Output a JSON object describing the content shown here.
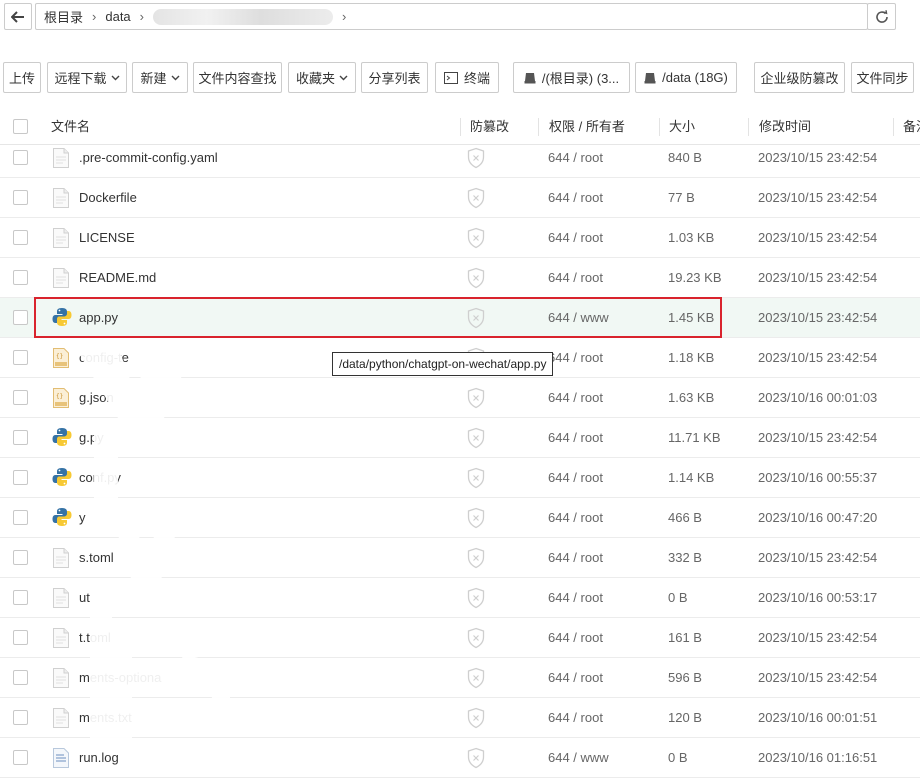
{
  "breadcrumb": {
    "root": "根目录",
    "seg1": "data"
  },
  "toolbar": {
    "upload": "上传",
    "remote_download": "远程下载",
    "new": "新建",
    "content_search": "文件内容查找",
    "favorites": "收藏夹",
    "share_list": "分享列表",
    "terminal": "终端",
    "disk_root": "/(根目录) (3...",
    "disk_data": "/data (18G)",
    "tamper_protect": "企业级防篡改",
    "file_sync": "文件同步"
  },
  "table": {
    "headers": {
      "name": "文件名",
      "tamper": "防篡改",
      "perm": "权限 / 所有者",
      "size": "大小",
      "mtime": "修改时间",
      "note": "备注"
    },
    "rows": [
      {
        "name": ".pre-commit-config.yaml",
        "perm": "644 / root",
        "size": "840 B",
        "mtime": "2023/10/15 23:42:54",
        "icon": "file-icon"
      },
      {
        "name": "Dockerfile",
        "perm": "644 / root",
        "size": "77 B",
        "mtime": "2023/10/15 23:42:54",
        "icon": "file-icon"
      },
      {
        "name": "LICENSE",
        "perm": "644 / root",
        "size": "1.03 KB",
        "mtime": "2023/10/15 23:42:54",
        "icon": "file-icon"
      },
      {
        "name": "README.md",
        "perm": "644 / root",
        "size": "19.23 KB",
        "mtime": "2023/10/15 23:42:54",
        "icon": "file-icon"
      },
      {
        "name": "app.py",
        "perm": "644 / www",
        "size": "1.45 KB",
        "mtime": "2023/10/15 23:42:54",
        "icon": "python-icon"
      },
      {
        "name": "config-te",
        "perm": "644 / root",
        "size": "1.18 KB",
        "mtime": "2023/10/15 23:42:54",
        "icon": "json-icon"
      },
      {
        "name": "g.json",
        "perm": "644 / root",
        "size": "1.63 KB",
        "mtime": "2023/10/16 00:01:03",
        "icon": "json-icon"
      },
      {
        "name": "g.py",
        "perm": "644 / root",
        "size": "11.71 KB",
        "mtime": "2023/10/15 23:42:54",
        "icon": "python-icon"
      },
      {
        "name": "conf.py",
        "perm": "644 / root",
        "size": "1.14 KB",
        "mtime": "2023/10/16 00:55:37",
        "icon": "python-icon"
      },
      {
        "name": "y",
        "perm": "644 / root",
        "size": "466 B",
        "mtime": "2023/10/16 00:47:20",
        "icon": "python-icon"
      },
      {
        "name": "s.toml",
        "perm": "644 / root",
        "size": "332 B",
        "mtime": "2023/10/15 23:42:54",
        "icon": "file-icon"
      },
      {
        "name": "ut",
        "perm": "644 / root",
        "size": "0 B",
        "mtime": "2023/10/16 00:53:17",
        "icon": "file-icon"
      },
      {
        "name": "t.toml",
        "perm": "644 / root",
        "size": "161 B",
        "mtime": "2023/10/15 23:42:54",
        "icon": "file-icon"
      },
      {
        "name": "ments-optiona",
        "perm": "644 / root",
        "size": "596 B",
        "mtime": "2023/10/15 23:42:54",
        "icon": "file-icon"
      },
      {
        "name": "ments.txt",
        "perm": "644 / root",
        "size": "120 B",
        "mtime": "2023/10/16 00:01:51",
        "icon": "file-icon"
      },
      {
        "name": "run.log",
        "perm": "644 / www",
        "size": "0 B",
        "mtime": "2023/10/16 01:16:51",
        "icon": "log-icon"
      }
    ]
  },
  "tooltip": "/data/python/chatgpt-on-wechat/app.py",
  "colors": {
    "highlight_row": "#f1f8f4",
    "selection_border": "#d9232d",
    "python_blue": "#3572a5",
    "python_yellow": "#f7c933",
    "json_tan": "#e8c37a"
  }
}
